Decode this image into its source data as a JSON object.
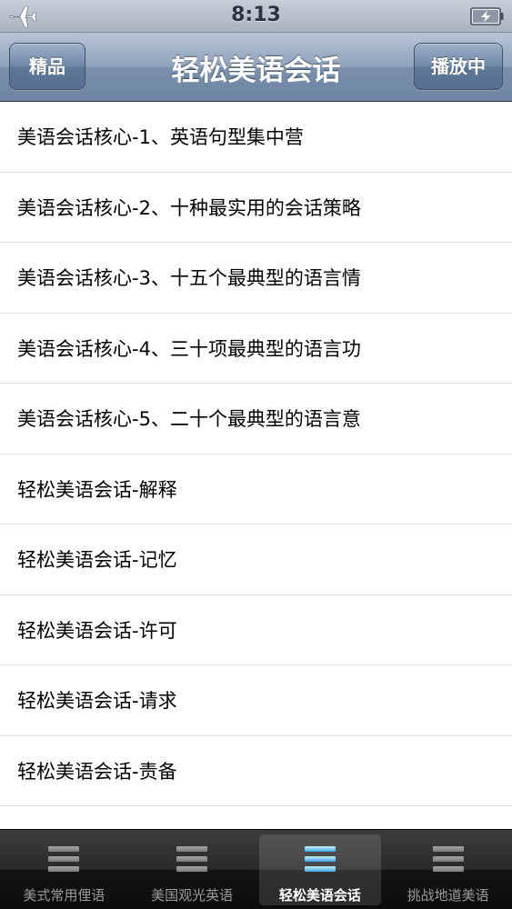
{
  "status_bar": {
    "time": "8:13",
    "airplane_icon": "airplane-icon",
    "battery_icon": "battery-charging-icon"
  },
  "nav_bar": {
    "title": "轻松美语会话",
    "left_button": "精品",
    "right_button": "播放中"
  },
  "list": {
    "items": [
      "美语会话核心-1、英语句型集中营",
      "美语会话核心-2、十种最实用的会话策略",
      "美语会话核心-3、十五个最典型的语言情",
      "美语会话核心-4、三十项最典型的语言功",
      "美语会话核心-5、二十个最典型的语言意",
      "轻松美语会话-解释",
      "轻松美语会话-记忆",
      "轻松美语会话-许可",
      "轻松美语会话-请求",
      "轻松美语会话-责备",
      ""
    ]
  },
  "tab_bar": {
    "icon": "list-icon",
    "selected_index": 2,
    "tabs": [
      {
        "label": "美式常用俚语"
      },
      {
        "label": "美国观光英语"
      },
      {
        "label": "轻松美语会话"
      },
      {
        "label": "挑战地道美语"
      }
    ]
  }
}
